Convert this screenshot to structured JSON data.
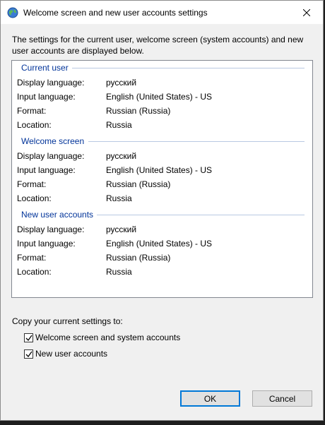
{
  "window": {
    "title": "Welcome screen and new user accounts settings"
  },
  "intro_text": "The settings for the current user, welcome screen (system accounts) and new user accounts are displayed below.",
  "labels": {
    "display_language": "Display language:",
    "input_language": "Input language:",
    "format": "Format:",
    "location": "Location:"
  },
  "sections": [
    {
      "title": "Current user",
      "display_language": "русский",
      "input_language": "English (United States) - US",
      "format": "Russian (Russia)",
      "location": "Russia"
    },
    {
      "title": "Welcome screen",
      "display_language": "русский",
      "input_language": "English (United States) - US",
      "format": "Russian (Russia)",
      "location": "Russia"
    },
    {
      "title": "New user accounts",
      "display_language": "русский",
      "input_language": "English (United States) - US",
      "format": "Russian (Russia)",
      "location": "Russia"
    }
  ],
  "copy_settings": {
    "label": "Copy your current settings to:",
    "options": [
      {
        "label": "Welcome screen and system accounts",
        "checked": true
      },
      {
        "label": "New user accounts",
        "checked": true
      }
    ]
  },
  "buttons": {
    "ok": "OK",
    "cancel": "Cancel"
  },
  "icons": {
    "app": "globe-icon",
    "close": "close-icon"
  },
  "colors": {
    "section_header": "#003399",
    "default_button_border": "#0078d7"
  }
}
